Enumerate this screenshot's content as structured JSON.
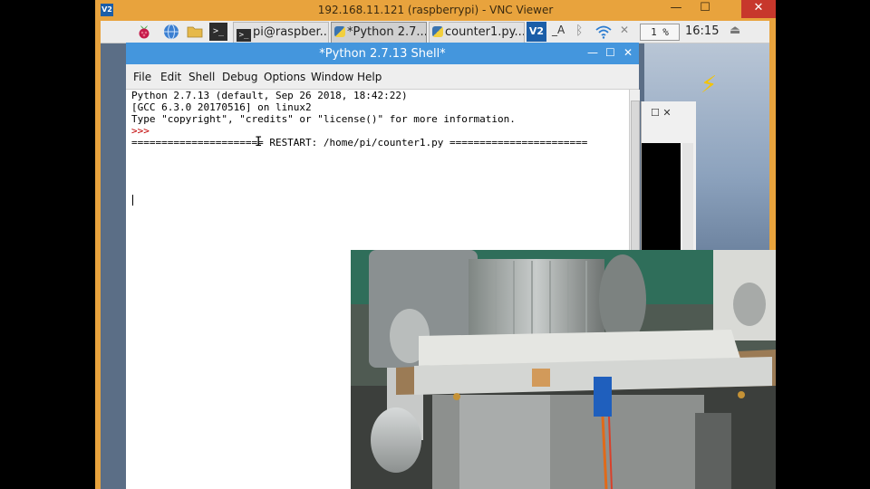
{
  "vnc": {
    "title": "192.168.11.121 (raspberrypi) - VNC Viewer",
    "logo": "V2",
    "minimize": "—",
    "maximize": "☐",
    "close": "✕"
  },
  "taskbar": {
    "icons": [
      "raspberry-menu-icon",
      "web-browser-icon",
      "file-manager-icon",
      "terminal-icon"
    ],
    "terminal_glyph": ">_",
    "tasks": [
      {
        "label": "pi@raspber...",
        "icon": "terminal-icon"
      },
      {
        "label": "*Python 2.7...",
        "icon": "python-icon"
      },
      {
        "label": "counter1.py...",
        "icon": "python-icon"
      }
    ],
    "vnc_icon": "V2",
    "font_icon": "_A",
    "bluetooth": "ᛒ",
    "volume": "✕",
    "cpu": "1 %",
    "clock": "16:15",
    "eject": "⏏"
  },
  "shell": {
    "title": "*Python 2.7.13 Shell*",
    "buttons": {
      "minimize": "—",
      "maximize": "☐",
      "close": "✕"
    },
    "menu": [
      {
        "label": "File"
      },
      {
        "label": "Edit"
      },
      {
        "label": "Shell"
      },
      {
        "label": "Debug"
      },
      {
        "label": "Options"
      },
      {
        "label": "Window"
      },
      {
        "label": "Help"
      }
    ],
    "lines": [
      "Python 2.7.13 (default, Sep 26 2018, 18:42:22)",
      "[GCC 6.3.0 20170516] on linux2",
      "Type \"copyright\", \"credits\" or \"license()\" for more information.",
      ">>> ",
      "====================== RESTART: /home/pi/counter1.py ======================="
    ]
  },
  "background_window": {
    "buttons": "☐  ✕"
  },
  "colors": {
    "vnc_frame": "#e8a33d",
    "shell_title": "#4496dd",
    "prompt": "#c00000",
    "taskbar": "#ececec"
  }
}
